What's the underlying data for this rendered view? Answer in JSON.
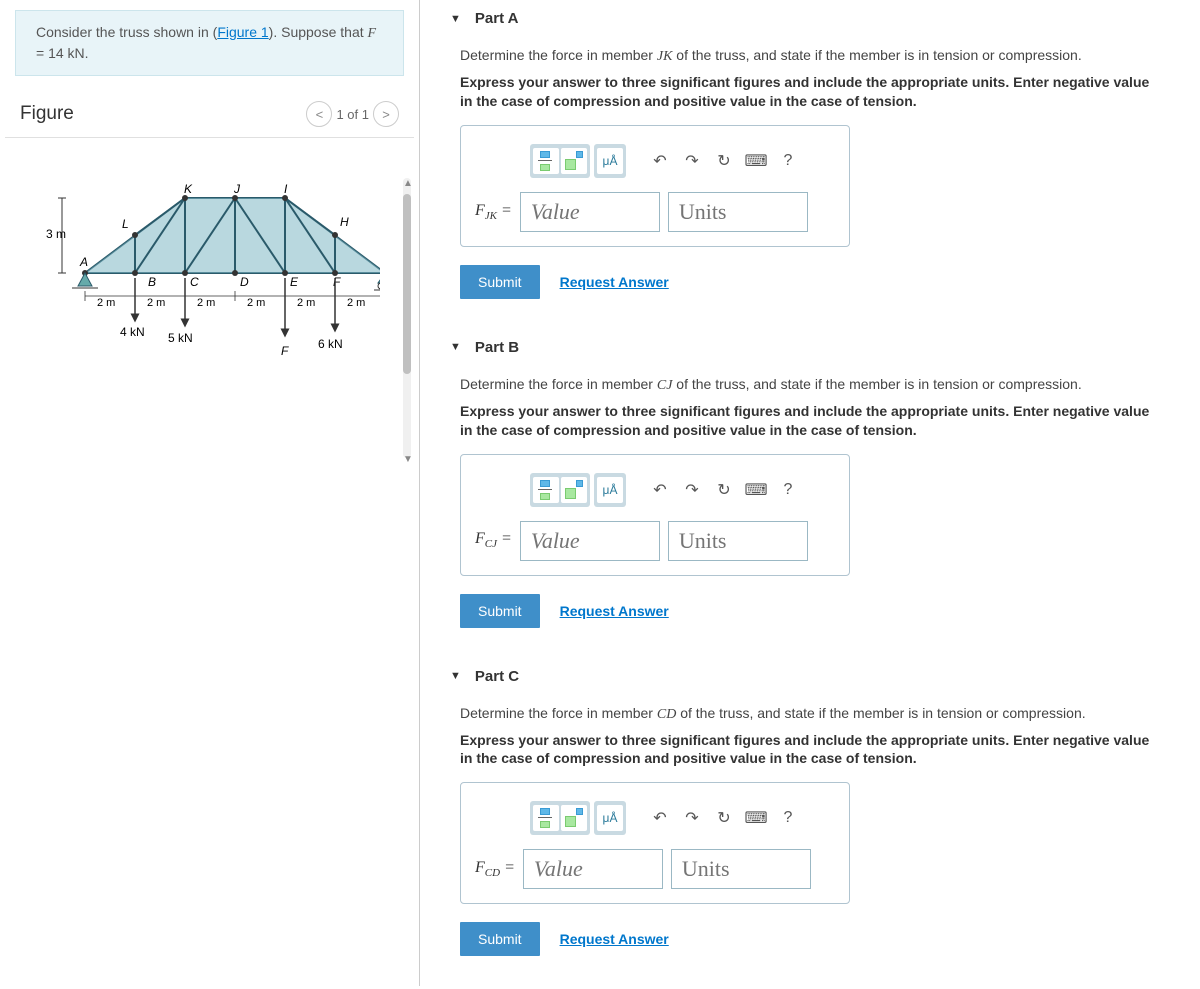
{
  "problem": {
    "prefix": "Consider the truss shown in (",
    "figure_link": "Figure 1",
    "suffix": "). Suppose that ",
    "var": "F",
    "equals": " = 14 kN."
  },
  "figure_panel": {
    "title": "Figure",
    "pager": "1 of 1"
  },
  "truss": {
    "height_label": "3 m",
    "nodes": {
      "A": "A",
      "B": "B",
      "C": "C",
      "D": "D",
      "E": "E",
      "F": "F",
      "G": "G",
      "H": "H",
      "I": "I",
      "J": "J",
      "K": "K",
      "L": "L"
    },
    "spans": [
      "2 m",
      "2 m",
      "2 m",
      "2 m",
      "2 m",
      "2 m"
    ],
    "loads": {
      "b": "4 kN",
      "c": "5 kN",
      "e": "F",
      "f": "6 kN"
    }
  },
  "parts": [
    {
      "id": "A",
      "header": "Part A",
      "q_pre": "Determine the force in member ",
      "q_member": "JK",
      "q_post": " of the truss, and state if the member is in tension or compression.",
      "instruction": "Express your answer to three significant figures and include the appropriate units. Enter negative value in the case of compression and positive value in the case of tension.",
      "var_html": "F<sub>JK</sub> =",
      "value_ph": "Value",
      "units_ph": "Units",
      "submit": "Submit",
      "request": "Request Answer"
    },
    {
      "id": "B",
      "header": "Part B",
      "q_pre": "Determine the force in member ",
      "q_member": "CJ",
      "q_post": " of the truss, and state if the member is in tension or compression.",
      "instruction": "Express your answer to three significant figures and include the appropriate units. Enter negative value in the case of compression and positive value in the case of tension.",
      "var_html": "F<sub>CJ</sub> =",
      "value_ph": "Value",
      "units_ph": "Units",
      "submit": "Submit",
      "request": "Request Answer"
    },
    {
      "id": "C",
      "header": "Part C",
      "q_pre": "Determine the force in member ",
      "q_member": "CD",
      "q_post": " of the truss, and state if the member is in tension or compression.",
      "instruction": "Express your answer to three significant figures and include the appropriate units. Enter negative value in the case of compression and positive value in the case of tension.",
      "var_html": "F<sub>CD</sub> =",
      "value_ph": "Value",
      "units_ph": "Units",
      "submit": "Submit",
      "request": "Request Answer"
    }
  ],
  "toolbar_labels": {
    "greek": "μÅ",
    "undo": "↶",
    "redo": "↷",
    "reset": "↻",
    "keyboard": "⌨",
    "help": "?"
  }
}
